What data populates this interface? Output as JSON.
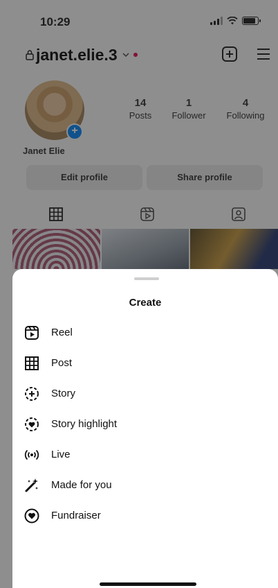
{
  "status_bar": {
    "time": "10:29"
  },
  "header": {
    "username": "janet.elie.3"
  },
  "profile": {
    "name": "Janet Elie",
    "stats": [
      {
        "value": "14",
        "label": "Posts"
      },
      {
        "value": "1",
        "label": "Follower"
      },
      {
        "value": "4",
        "label": "Following"
      }
    ],
    "buttons": {
      "edit": "Edit profile",
      "share": "Share profile"
    }
  },
  "sheet": {
    "title": "Create",
    "items": [
      {
        "label": "Reel",
        "icon": "reel-icon"
      },
      {
        "label": "Post",
        "icon": "grid-icon"
      },
      {
        "label": "Story",
        "icon": "story-add-icon"
      },
      {
        "label": "Story highlight",
        "icon": "story-highlight-icon"
      },
      {
        "label": "Live",
        "icon": "live-icon"
      },
      {
        "label": "Made for you",
        "icon": "magic-wand-icon"
      },
      {
        "label": "Fundraiser",
        "icon": "fundraiser-icon"
      }
    ]
  },
  "colors": {
    "accent_blue": "#1c8ef0",
    "notification_red": "#e0245e",
    "overlay": "rgba(0,0,0,0.42)"
  }
}
